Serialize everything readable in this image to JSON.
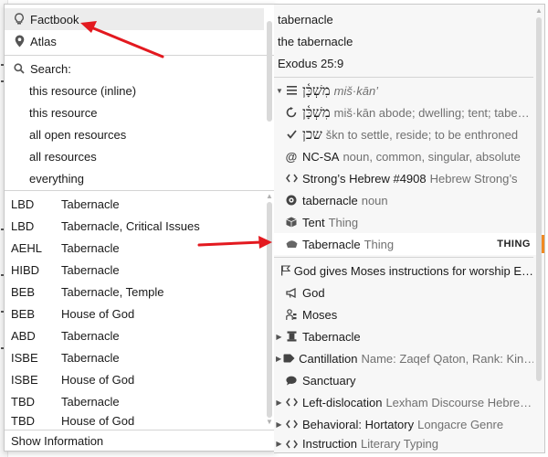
{
  "menu": {
    "top_items": [
      {
        "icon": "lightbulb-icon",
        "label": "Factbook"
      },
      {
        "icon": "map-pin-icon",
        "label": "Atlas"
      }
    ],
    "search_label": "Search:",
    "search_scopes": [
      "this resource (inline)",
      "this resource",
      "all open resources",
      "all resources",
      "everything"
    ],
    "resources": [
      {
        "abbr": "LBD",
        "title": "Tabernacle"
      },
      {
        "abbr": "LBD",
        "title": "Tabernacle, Critical Issues"
      },
      {
        "abbr": "AEHL",
        "title": "Tabernacle"
      },
      {
        "abbr": "HIBD",
        "title": "Tabernacle"
      },
      {
        "abbr": "BEB",
        "title": "Tabernacle, Temple"
      },
      {
        "abbr": "BEB",
        "title": "House of God"
      },
      {
        "abbr": "ABD",
        "title": "Tabernacle"
      },
      {
        "abbr": "ISBE",
        "title": "Tabernacle"
      },
      {
        "abbr": "ISBE",
        "title": "House of God"
      },
      {
        "abbr": "TBD",
        "title": "Tabernacle"
      },
      {
        "abbr": "TBD",
        "title": "House of God"
      }
    ],
    "show_information": "Show Information"
  },
  "panel": {
    "head": [
      "tabernacle",
      "the tabernacle",
      "Exodus 25:9"
    ],
    "items": [
      {
        "text": "מִשְׁכָּ֫ן",
        "gray": "miš·kān’"
      },
      {
        "text": "מִשְׁכָּ֫ן",
        "gray": "miš·kān abode; dwelling; tent; tabe…"
      },
      {
        "text": "שכן",
        "gray": "škn to settle, reside; to be enthroned"
      },
      {
        "text": "NC-SA",
        "gray": "noun, common, singular, absolute"
      },
      {
        "text": "Strong’s Hebrew #4908",
        "gray": "Hebrew Strong’s"
      },
      {
        "text": "tabernacle",
        "gray": "noun"
      },
      {
        "text": "Tent",
        "gray": "Thing"
      },
      {
        "text": "Tabernacle",
        "gray": "Thing",
        "tag": "THING"
      },
      {
        "text": "God gives Moses instructions for worship E…",
        "gray": ""
      },
      {
        "text": "God",
        "gray": ""
      },
      {
        "text": "Moses",
        "gray": ""
      },
      {
        "text": "Tabernacle",
        "gray": ""
      },
      {
        "text": "Cantillation",
        "gray": "Name: Zaqef Qaton, Rank: Kin…"
      },
      {
        "text": "Sanctuary",
        "gray": ""
      },
      {
        "text": "Left-dislocation",
        "gray": "Lexham Discourse Hebre…"
      },
      {
        "text": "Behavioral: Hortatory",
        "gray": "Longacre Genre"
      },
      {
        "text": "Instruction",
        "gray": "Literary Typing"
      }
    ]
  },
  "colors": {
    "arrow": "#e3191f",
    "selection_bar": "#f08a24"
  }
}
